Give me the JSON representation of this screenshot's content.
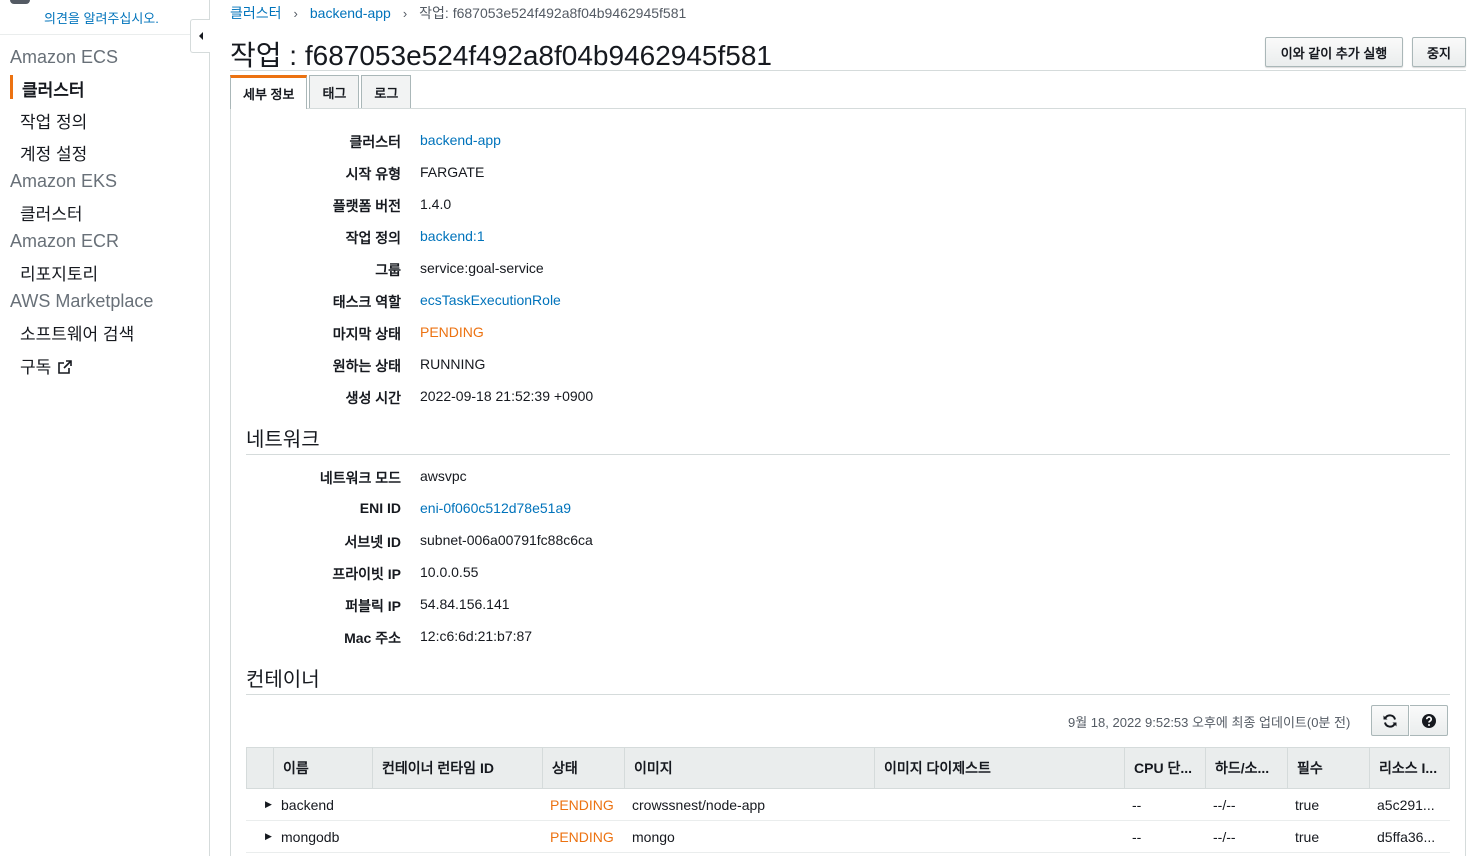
{
  "sidebar": {
    "feedback_link": "의견을 알려주십시오.",
    "sections": [
      {
        "title": "Amazon ECS",
        "items": [
          "클러스터",
          "작업 정의",
          "계정 설정"
        ]
      },
      {
        "title": "Amazon EKS",
        "items": [
          "클러스터"
        ]
      },
      {
        "title": "Amazon ECR",
        "items": [
          "리포지토리"
        ]
      },
      {
        "title": "AWS Marketplace",
        "items": [
          "소프트웨어 검색",
          "구독"
        ]
      }
    ],
    "active_item": "클러스터",
    "accent_color": "#ec7211"
  },
  "breadcrumb": {
    "items": [
      "클러스터",
      "backend-app"
    ],
    "current": "작업: f687053e524f492a8f04b9462945f581"
  },
  "header": {
    "title": "작업 : f687053e524f492a8f04b9462945f581",
    "run_more_button": "이와 같이 추가 실행",
    "stop_button": "중지"
  },
  "tabs": [
    {
      "label": "세부 정보",
      "active": true
    },
    {
      "label": "태그",
      "active": false
    },
    {
      "label": "로그",
      "active": false
    }
  ],
  "details": [
    {
      "label": "클러스터",
      "value": "backend-app",
      "style": "link"
    },
    {
      "label": "시작 유형",
      "value": "FARGATE",
      "style": "plain"
    },
    {
      "label": "플랫폼 버전",
      "value": "1.4.0",
      "style": "plain"
    },
    {
      "label": "작업 정의",
      "value": "backend:1",
      "style": "link"
    },
    {
      "label": "그룹",
      "value": "service:goal-service",
      "style": "plain"
    },
    {
      "label": "태스크 역할",
      "value": "ecsTaskExecutionRole",
      "style": "link"
    },
    {
      "label": "마지막 상태",
      "value": "PENDING",
      "style": "pending"
    },
    {
      "label": "원하는 상태",
      "value": "RUNNING",
      "style": "plain"
    },
    {
      "label": "생성 시간",
      "value": "2022-09-18 21:52:39 +0900",
      "style": "plain"
    }
  ],
  "network": {
    "title": "네트워크",
    "rows": [
      {
        "label": "네트워크 모드",
        "value": "awsvpc",
        "style": "plain"
      },
      {
        "label": "ENI ID",
        "value": "eni-0f060c512d78e51a9",
        "style": "link"
      },
      {
        "label": "서브넷 ID",
        "value": "subnet-006a00791fc88c6ca",
        "style": "plain"
      },
      {
        "label": "프라이빗 IP",
        "value": "10.0.0.55",
        "style": "plain"
      },
      {
        "label": "퍼블릭 IP",
        "value": "54.84.156.141",
        "style": "plain"
      },
      {
        "label": "Mac 주소",
        "value": "12:c6:6d:21:b7:87",
        "style": "plain"
      }
    ]
  },
  "containers": {
    "title": "컨테이너",
    "last_updated": "9월 18, 2022 9:52:53 오후에 최종 업데이트(0분 전)",
    "columns": [
      "이름",
      "컨테이너 런타임 ID",
      "상태",
      "이미지",
      "이미지 다이제스트",
      "CPU 단...",
      "하드/소...",
      "필수",
      "리소스 I..."
    ],
    "rows": [
      {
        "name": "backend",
        "runtime_id": "",
        "status": "PENDING",
        "image": "crowssnest/node-app",
        "digest": "",
        "cpu": "--",
        "memory": "--/--",
        "essential": "true",
        "resource": "a5c291..."
      },
      {
        "name": "mongodb",
        "runtime_id": "",
        "status": "PENDING",
        "image": "mongo",
        "digest": "",
        "cpu": "--",
        "memory": "--/--",
        "essential": "true",
        "resource": "d5ffa36..."
      }
    ]
  },
  "colors": {
    "link": "#0073bb",
    "pending": "#ec7211",
    "text": "#16191f"
  }
}
